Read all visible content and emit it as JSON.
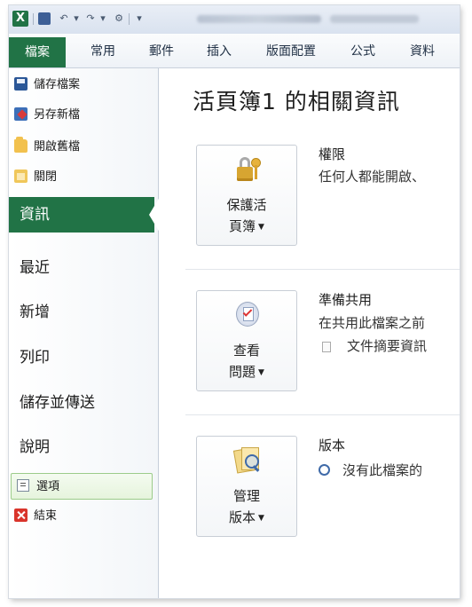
{
  "qat": {
    "app_icon": "X"
  },
  "tabs": {
    "file": "檔案",
    "home": "常用",
    "mailings": "郵件",
    "insert": "插入",
    "page_layout": "版面配置",
    "formulas": "公式",
    "data": "資料"
  },
  "nav": {
    "save": "儲存檔案",
    "save_as": "另存新檔",
    "open": "開啟舊檔",
    "close": "關閉",
    "info": "資訊",
    "recent": "最近",
    "new": "新增",
    "print": "列印",
    "save_send": "儲存並傳送",
    "help": "說明",
    "options": "選項",
    "exit": "結束"
  },
  "content": {
    "title": "活頁簿1 的相關資訊",
    "permissions": {
      "button_line1": "保護活",
      "button_line2": "頁簿",
      "heading": "權限",
      "description": "任何人都能開啟、"
    },
    "prepare": {
      "button_line1": "查看",
      "button_line2": "問題",
      "heading": "準備共用",
      "description": "在共用此檔案之前",
      "bullet": "文件摘要資訊"
    },
    "versions": {
      "button_line1": "管理",
      "button_line2": "版本",
      "heading": "版本",
      "description": "沒有此檔案的"
    }
  },
  "icons": {
    "save": "save-icon",
    "save_as": "save-as-icon",
    "open": "open-folder-icon",
    "close": "close-folder-icon",
    "options": "options-icon",
    "exit": "exit-icon",
    "protect": "lock-key-icon",
    "check": "check-issues-icon",
    "versions": "manage-versions-icon"
  },
  "colors": {
    "accent": "#217346",
    "options_highlight": "#e6f4dd"
  }
}
